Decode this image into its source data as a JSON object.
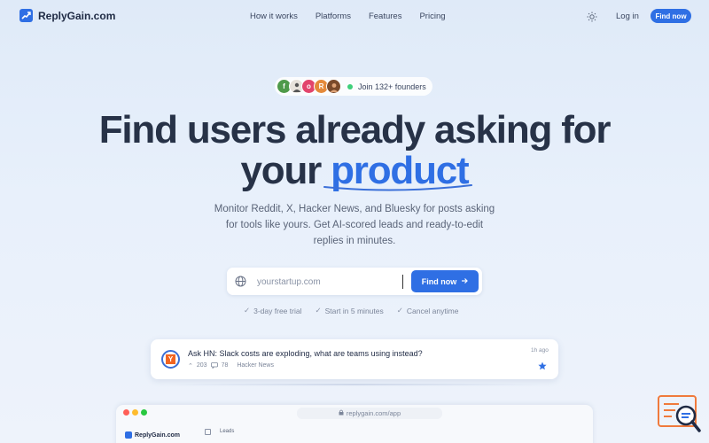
{
  "nav": {
    "logo_text": "ReplyGain.com",
    "links": [
      "How it works",
      "Platforms",
      "Features",
      "Pricing"
    ],
    "login": "Log in",
    "cta": "Find now"
  },
  "hero": {
    "pill_text": "Join 132+ founders",
    "avatars": [
      {
        "letter": "f",
        "color": "#4f9a4a"
      },
      {
        "letter": "",
        "color": "#e7e2db"
      },
      {
        "letter": "o",
        "color": "#e2456c"
      },
      {
        "letter": "R",
        "color": "#e48a3b"
      },
      {
        "letter": "",
        "color": "#7a4a2b"
      }
    ],
    "title_line1": "Find users already asking for",
    "title_line2_plain": "your",
    "title_line2_accent": "product",
    "subtitle": "Monitor Reddit, X, Hacker News, and Bluesky for posts asking for tools like yours. Get AI-scored leads and ready-to-edit replies in minutes."
  },
  "search": {
    "placeholder": "yourstartup.com",
    "button": "Find now"
  },
  "perks": [
    "3-day free trial",
    "Start in 5 minutes",
    "Cancel anytime"
  ],
  "card": {
    "source_letter": "Y",
    "title": "Ask HN: Slack costs are exploding, what are teams using instead?",
    "upvotes": "203",
    "comments": "78",
    "platform": "Hacker News",
    "time": "1h ago"
  },
  "browser": {
    "url": "replygain.com/app",
    "app_logo": "ReplyGain.com",
    "section": "Leads"
  },
  "colors": {
    "accent": "#2f6fe4",
    "brand_orange": "#f26522"
  }
}
